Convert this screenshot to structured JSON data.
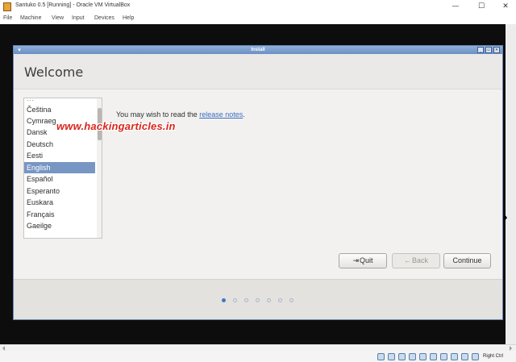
{
  "window": {
    "title": "Santuko 0.5 [Running] - Oracle VM VirtualBox",
    "minimize": "—",
    "maximize": "☐",
    "close": "✕"
  },
  "menubar": [
    "File",
    "Machine",
    "View",
    "Input",
    "Devices",
    "Help"
  ],
  "dialog": {
    "title": "Install",
    "heading": "Welcome",
    "languages": [
      "Čeština",
      "Cymraeg",
      "Dansk",
      "Deutsch",
      "Eesti",
      "English",
      "Español",
      "Esperanto",
      "Euskara",
      "Français",
      "Gaeilge"
    ],
    "selected_language": "English",
    "notes_prefix": "You may wish to read the ",
    "notes_link": "release notes",
    "notes_suffix": ".",
    "buttons": {
      "quit": "Quit",
      "back": "Back",
      "continue": "Continue"
    },
    "steps": {
      "total": 7,
      "current": 1
    }
  },
  "watermark": "www.hackingarticles.in",
  "statusbar": {
    "host_key": "Right Ctrl"
  },
  "colors": {
    "selection": "#7896c3",
    "link": "#3a6fbf",
    "active_step": "#3a78c7"
  }
}
